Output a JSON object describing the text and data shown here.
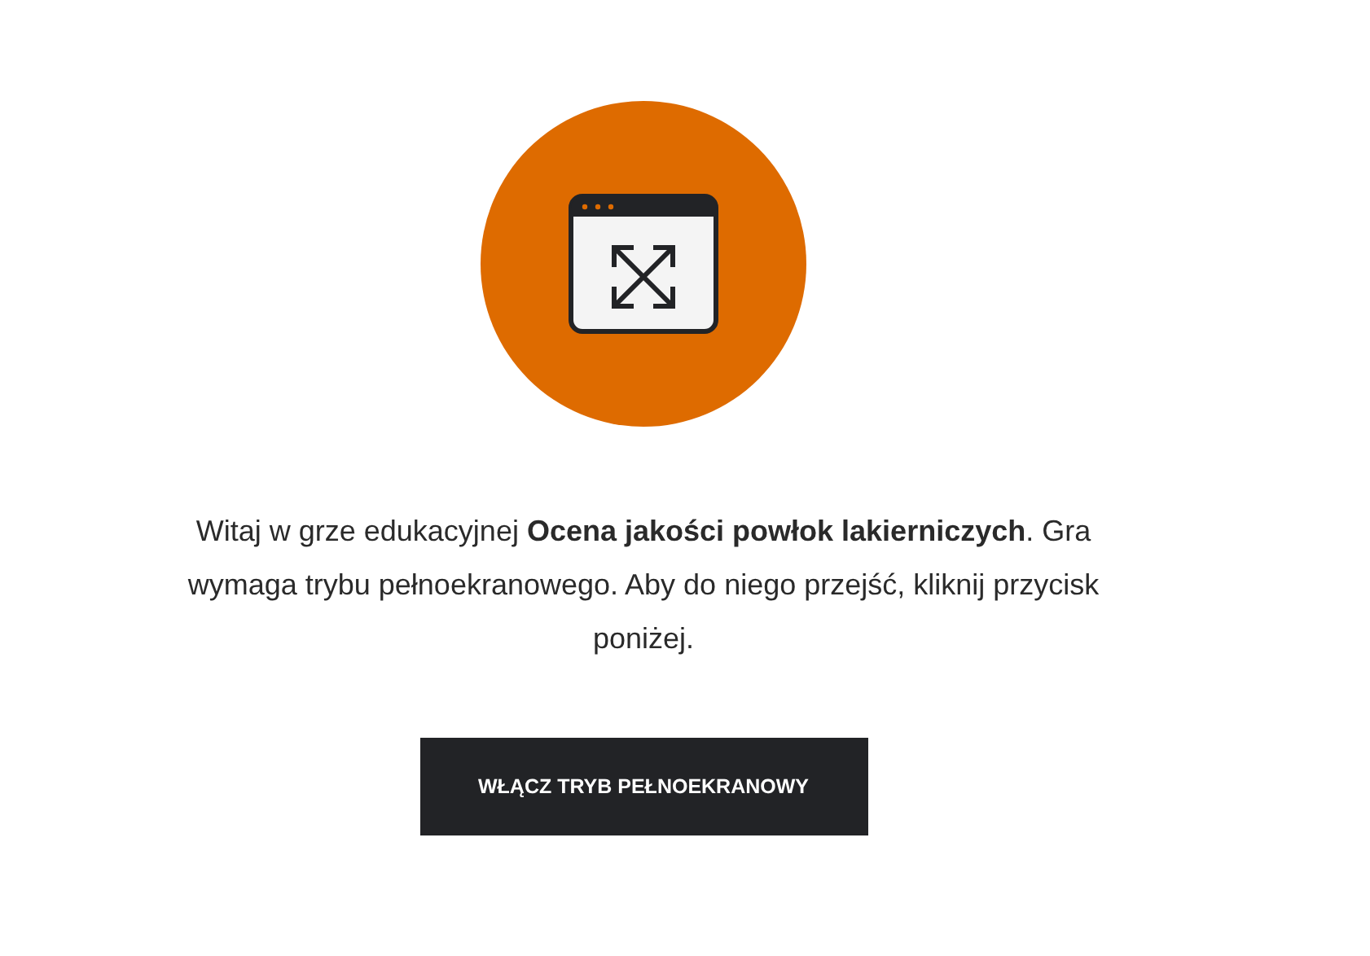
{
  "intro": {
    "text": "Witaj w grze edukacyjnej **Ocena jakości powłok lakierniczych**. Gra wymaga trybu pełnoekranowego. Aby do niego przejść, kliknij przycisk poniżej."
  },
  "button": {
    "label": "WŁĄCZ TRYB PEŁNOEKRANOWY"
  }
}
